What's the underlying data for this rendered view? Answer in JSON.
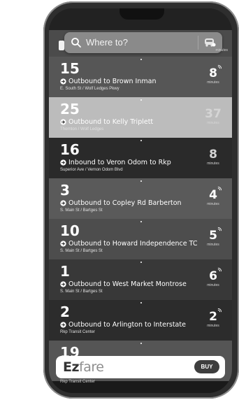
{
  "search": {
    "placeholder": "Where to?"
  },
  "top_partial": {
    "eta_label": "minutes"
  },
  "routes": [
    {
      "number": "15",
      "destination": "Outbound to Brown Inman",
      "stop": "E. South St / Wolf Ledges Pkwy",
      "eta": "8",
      "eta_label": "minutes",
      "live": true,
      "bg": "#565656"
    },
    {
      "number": "25",
      "destination": "Outbound to Kelly Triplett",
      "stop": "Thornton / Wolf Ledges",
      "eta": "37",
      "eta_label": "minutes",
      "live": false,
      "bg": "#bcbcbc"
    },
    {
      "number": "16",
      "destination": "Inbound to Veron Odom to Rkp",
      "stop": "Superior Ave / Vernon Odom Blvd",
      "eta": "8",
      "eta_label": "minutes",
      "live": false,
      "bg": "#2a2a2a"
    },
    {
      "number": "3",
      "destination": "Outbound to Copley Rd Barberton",
      "stop": "S. Main St / Bartges St",
      "eta": "4",
      "eta_label": "minutes",
      "live": true,
      "bg": "#5a5a5a"
    },
    {
      "number": "10",
      "destination": "Outbound to Howard Independence TC",
      "stop": "S. Main St / Bartges St",
      "eta": "5",
      "eta_label": "minutes",
      "live": true,
      "bg": "#4d4d4d"
    },
    {
      "number": "1",
      "destination": "Outbound to West Market Montrose",
      "stop": "S. Main St / Bartges St",
      "eta": "6",
      "eta_label": "minutes",
      "live": true,
      "bg": "#383838"
    },
    {
      "number": "2",
      "destination": "Outbound to Arlington to Interstate",
      "stop": "Rkp Transit Center",
      "eta": "2",
      "eta_label": "minutes",
      "live": true,
      "bg": "#2c2c2c"
    },
    {
      "number": "19",
      "destination": "",
      "stop": "",
      "eta": "",
      "eta_label": "",
      "live": false,
      "bg": "#555555"
    }
  ],
  "bottom_partial_stop": "Rkp Transit Center",
  "ezfare": {
    "logo_ez": "Ez",
    "logo_fare": "fare",
    "buy_label": "BUY"
  },
  "colors": {
    "ezfare_dark": "#333333",
    "ezfare_light": "#8e8e8e",
    "buy_bg": "#3e3e3e"
  }
}
